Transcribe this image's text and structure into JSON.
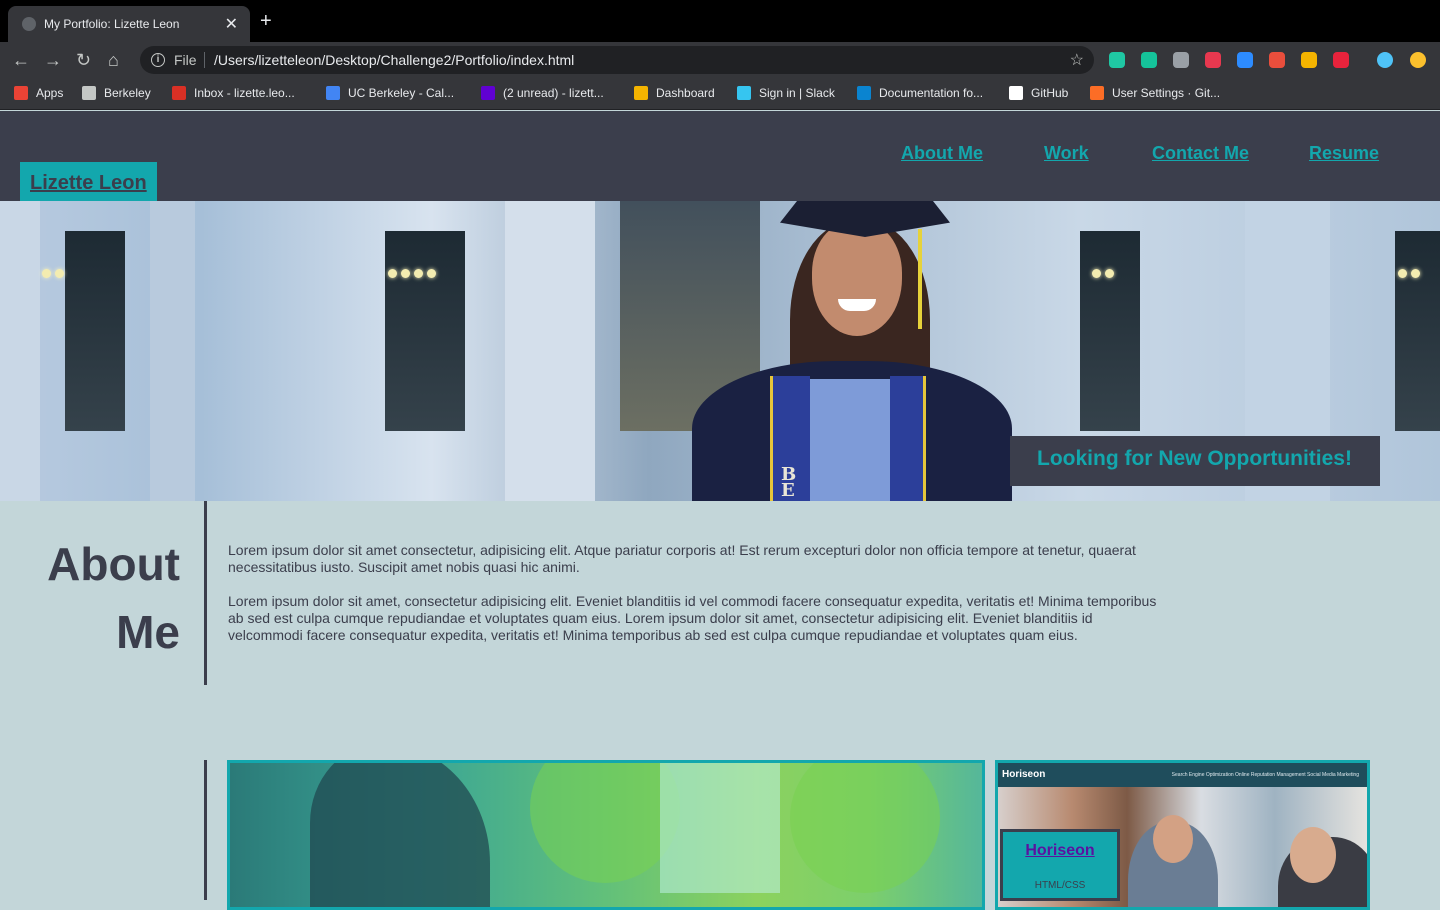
{
  "browser": {
    "tab_title": "My Portfolio: Lizette Leon",
    "url_scheme": "File",
    "url_path": "/Users/lizetteleon/Desktop/Challenge2/Portfolio/index.html",
    "bookmarks": [
      {
        "label": "Apps",
        "icon": "apps-grid-icon",
        "color": "#ea4335"
      },
      {
        "label": "Berkeley",
        "icon": "folder-icon",
        "color": "#c4c7c5"
      },
      {
        "label": "Inbox - lizette.leo...",
        "icon": "gmail-icon",
        "color": "#d93025"
      },
      {
        "label": "UC Berkeley - Cal...",
        "icon": "calendar-icon",
        "color": "#4285f4"
      },
      {
        "label": "(2 unread) - lizett...",
        "icon": "yahoo-mail-icon",
        "color": "#6001d2"
      },
      {
        "label": "Dashboard",
        "icon": "dashboard-icon",
        "color": "#f4b400"
      },
      {
        "label": "Sign in | Slack",
        "icon": "slack-icon",
        "color": "#36c5f0"
      },
      {
        "label": "Documentation fo...",
        "icon": "vscode-icon",
        "color": "#0a84d0"
      },
      {
        "label": "GitHub",
        "icon": "github-icon",
        "color": "#ffffff"
      },
      {
        "label": "User Settings · Git...",
        "icon": "gitlab-icon",
        "color": "#fc6d26"
      }
    ],
    "extension_colors": [
      "#1fc7a3",
      "#15c39a",
      "#9aa0a6",
      "#e8384f",
      "#2d8cff",
      "#e94e3c",
      "#f5b400",
      "#e8233c",
      "#4fc3f7",
      "#fbc02d"
    ]
  },
  "header": {
    "logo": "Lizette Leon",
    "nav": [
      "About Me",
      "Work",
      "Contact Me",
      "Resume"
    ]
  },
  "hero": {
    "tagline": "Looking for New Opportunities!",
    "gown_letters": "B\nE"
  },
  "about": {
    "title": "About Me",
    "paragraph1": "Lorem ipsum dolor sit amet consectetur, adipisicing elit. Atque pariatur corporis at! Est rerum excepturi dolor non officia tempore at tenetur, quaerat necessitatibus iusto. Suscipit amet nobis quasi hic animi.",
    "paragraph2": "Lorem ipsum dolor sit amet, consectetur adipisicing elit. Eveniet blanditiis id vel commodi facere consequatur expedita, veritatis et! Minima temporibus ab sed est culpa cumque repudiandae et voluptates quam eius. Lorem ipsum dolor sit amet, consectetur adipisicing elit. Eveniet blanditiis id velcommodi facere consequatur expedita, veritatis et! Minima temporibus ab sed est culpa cumque repudiandae et voluptates quam eius."
  },
  "work": {
    "horiseon_brand": "Horiseon",
    "horiseon_menu": "Search Engine Optimization    Online Reputation Management    Social Media Marketing",
    "project_title": "Horiseon",
    "project_tech": "HTML/CSS"
  },
  "colors": {
    "accent": "#13a7ad",
    "header_bg": "#3b3e4c",
    "page_bg": "#c3d6d9"
  }
}
